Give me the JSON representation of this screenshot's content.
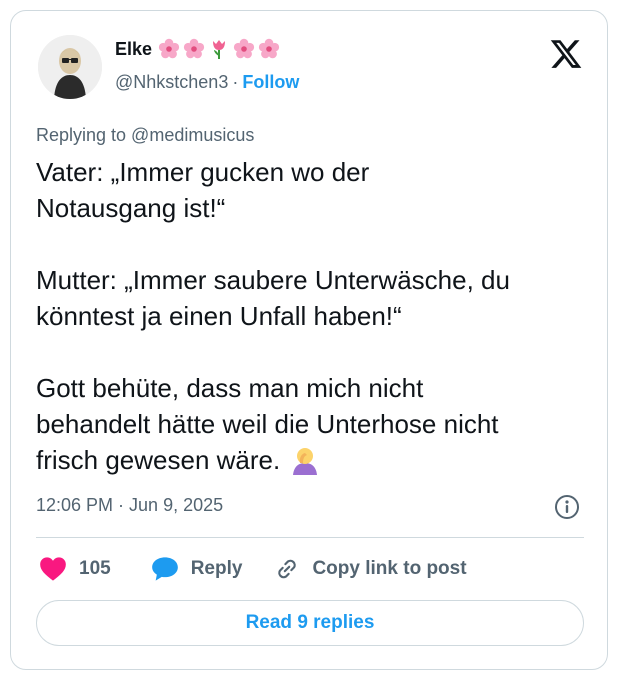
{
  "author": {
    "name": "Elke",
    "handle": "@Nhkstchen3",
    "separator": "·",
    "follow_label": "Follow",
    "flower_icons": [
      "cherry-blossom-icon",
      "cherry-blossom-icon",
      "tulip-icon",
      "cherry-blossom-icon",
      "cherry-blossom-icon"
    ]
  },
  "tweet": {
    "replying_to": "Replying to @medimusicus",
    "paragraphs": [
      [
        "Vater: „Immer gucken wo der",
        "Notausgang ist!“"
      ],
      [
        "Mutter: „Immer saubere Unterwäsche, du",
        "könntest ja einen Unfall haben!“"
      ],
      [
        "Gott behüte, dass man mich nicht",
        "behandelt hätte weil die Unterhose nicht",
        "frisch gewesen wäre."
      ]
    ],
    "timestamp": "12:06 PM · Jun 9, 2025"
  },
  "actions": {
    "like_count": "105",
    "reply_label": "Reply",
    "copy_label": "Copy link to post"
  },
  "read_replies_label": "Read 9 replies",
  "colors": {
    "accent": "#1d9bf0",
    "like": "#f91880",
    "muted": "#536471",
    "border": "#cfd9de"
  }
}
